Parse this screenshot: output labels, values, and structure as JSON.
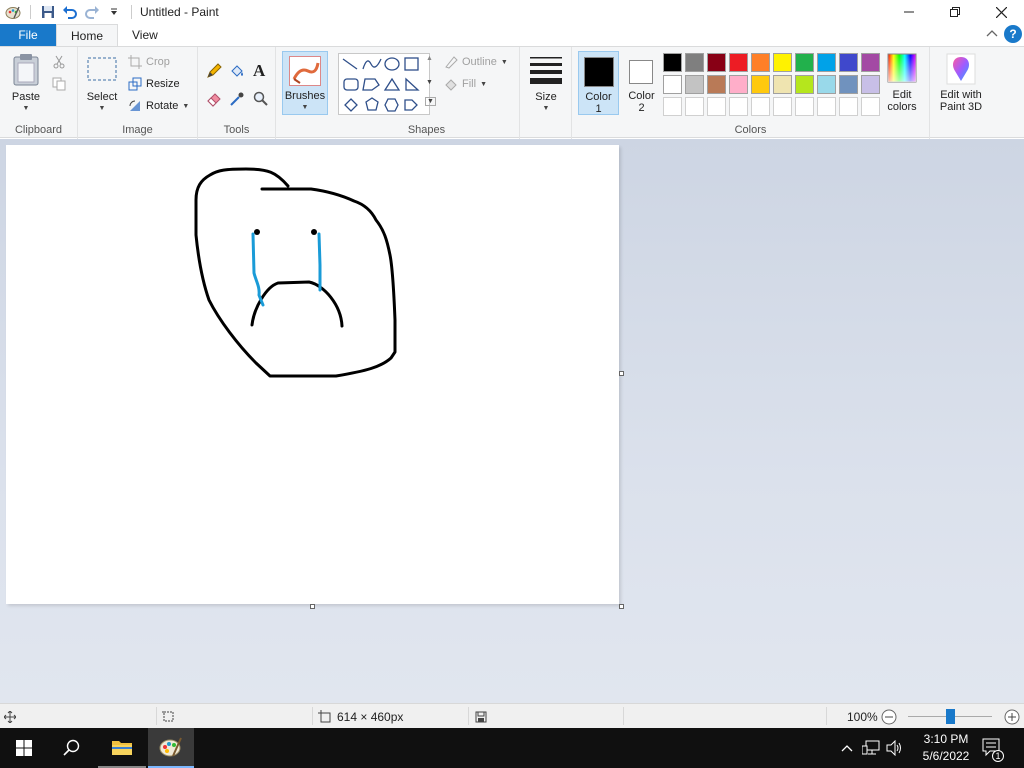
{
  "window": {
    "title": "Untitled - Paint"
  },
  "tabs": {
    "file": "File",
    "home": "Home",
    "view": "View"
  },
  "clipboard": {
    "paste": "Paste",
    "label": "Clipboard"
  },
  "image": {
    "select": "Select",
    "crop": "Crop",
    "resize": "Resize",
    "rotate": "Rotate",
    "label": "Image"
  },
  "tools": {
    "label": "Tools"
  },
  "brushes": {
    "label": "Brushes"
  },
  "shapes": {
    "outline": "Outline",
    "fill": "Fill",
    "label": "Shapes"
  },
  "size": {
    "label": "Size"
  },
  "colors": {
    "color1": "Color",
    "color1_num": "1",
    "color2": "Color",
    "color2_num": "2",
    "edit_colors_1": "Edit",
    "edit_colors_2": "colors",
    "label": "Colors",
    "palette_row1": [
      "#000000",
      "#7f7f7f",
      "#880015",
      "#ed1c24",
      "#ff7f27",
      "#fff200",
      "#22b14c",
      "#00a2e8",
      "#3f48cc",
      "#a349a4"
    ],
    "palette_row2": [
      "#ffffff",
      "#c3c3c3",
      "#b97a57",
      "#ffaec9",
      "#ffc90e",
      "#efe4b0",
      "#b5e61d",
      "#99d9ea",
      "#7092be",
      "#c8bfe7"
    ],
    "color1_value": "#000000",
    "color2_value": "#ffffff"
  },
  "paint3d": {
    "line1": "Edit with",
    "line2": "Paint 3D"
  },
  "status": {
    "dimensions": "614 × 460px",
    "zoom": "100%",
    "zoom_level": 1.0
  },
  "taskbar": {
    "time": "3:10 PM",
    "date": "5/6/2022",
    "notifications": "1"
  }
}
